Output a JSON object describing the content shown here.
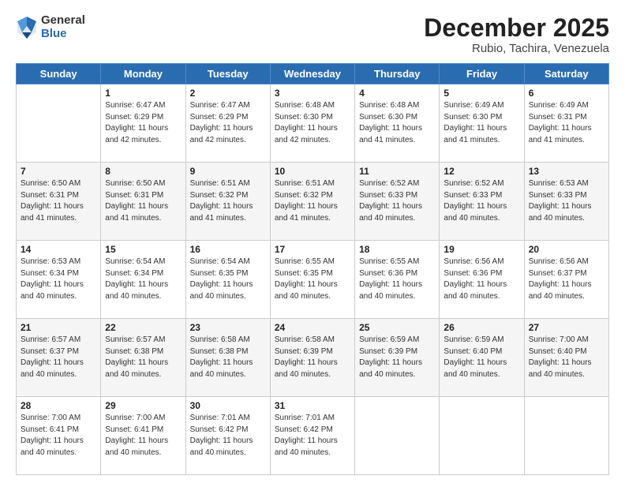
{
  "logo": {
    "general": "General",
    "blue": "Blue"
  },
  "header": {
    "month": "December 2025",
    "location": "Rubio, Tachira, Venezuela"
  },
  "days": [
    "Sunday",
    "Monday",
    "Tuesday",
    "Wednesday",
    "Thursday",
    "Friday",
    "Saturday"
  ],
  "weeks": [
    [
      {
        "num": "",
        "text": ""
      },
      {
        "num": "1",
        "text": "Sunrise: 6:47 AM\nSunset: 6:29 PM\nDaylight: 11 hours\nand 42 minutes."
      },
      {
        "num": "2",
        "text": "Sunrise: 6:47 AM\nSunset: 6:29 PM\nDaylight: 11 hours\nand 42 minutes."
      },
      {
        "num": "3",
        "text": "Sunrise: 6:48 AM\nSunset: 6:30 PM\nDaylight: 11 hours\nand 42 minutes."
      },
      {
        "num": "4",
        "text": "Sunrise: 6:48 AM\nSunset: 6:30 PM\nDaylight: 11 hours\nand 41 minutes."
      },
      {
        "num": "5",
        "text": "Sunrise: 6:49 AM\nSunset: 6:30 PM\nDaylight: 11 hours\nand 41 minutes."
      },
      {
        "num": "6",
        "text": "Sunrise: 6:49 AM\nSunset: 6:31 PM\nDaylight: 11 hours\nand 41 minutes."
      }
    ],
    [
      {
        "num": "7",
        "text": "Sunrise: 6:50 AM\nSunset: 6:31 PM\nDaylight: 11 hours\nand 41 minutes."
      },
      {
        "num": "8",
        "text": "Sunrise: 6:50 AM\nSunset: 6:31 PM\nDaylight: 11 hours\nand 41 minutes."
      },
      {
        "num": "9",
        "text": "Sunrise: 6:51 AM\nSunset: 6:32 PM\nDaylight: 11 hours\nand 41 minutes."
      },
      {
        "num": "10",
        "text": "Sunrise: 6:51 AM\nSunset: 6:32 PM\nDaylight: 11 hours\nand 41 minutes."
      },
      {
        "num": "11",
        "text": "Sunrise: 6:52 AM\nSunset: 6:33 PM\nDaylight: 11 hours\nand 40 minutes."
      },
      {
        "num": "12",
        "text": "Sunrise: 6:52 AM\nSunset: 6:33 PM\nDaylight: 11 hours\nand 40 minutes."
      },
      {
        "num": "13",
        "text": "Sunrise: 6:53 AM\nSunset: 6:33 PM\nDaylight: 11 hours\nand 40 minutes."
      }
    ],
    [
      {
        "num": "14",
        "text": "Sunrise: 6:53 AM\nSunset: 6:34 PM\nDaylight: 11 hours\nand 40 minutes."
      },
      {
        "num": "15",
        "text": "Sunrise: 6:54 AM\nSunset: 6:34 PM\nDaylight: 11 hours\nand 40 minutes."
      },
      {
        "num": "16",
        "text": "Sunrise: 6:54 AM\nSunset: 6:35 PM\nDaylight: 11 hours\nand 40 minutes."
      },
      {
        "num": "17",
        "text": "Sunrise: 6:55 AM\nSunset: 6:35 PM\nDaylight: 11 hours\nand 40 minutes."
      },
      {
        "num": "18",
        "text": "Sunrise: 6:55 AM\nSunset: 6:36 PM\nDaylight: 11 hours\nand 40 minutes."
      },
      {
        "num": "19",
        "text": "Sunrise: 6:56 AM\nSunset: 6:36 PM\nDaylight: 11 hours\nand 40 minutes."
      },
      {
        "num": "20",
        "text": "Sunrise: 6:56 AM\nSunset: 6:37 PM\nDaylight: 11 hours\nand 40 minutes."
      }
    ],
    [
      {
        "num": "21",
        "text": "Sunrise: 6:57 AM\nSunset: 6:37 PM\nDaylight: 11 hours\nand 40 minutes."
      },
      {
        "num": "22",
        "text": "Sunrise: 6:57 AM\nSunset: 6:38 PM\nDaylight: 11 hours\nand 40 minutes."
      },
      {
        "num": "23",
        "text": "Sunrise: 6:58 AM\nSunset: 6:38 PM\nDaylight: 11 hours\nand 40 minutes."
      },
      {
        "num": "24",
        "text": "Sunrise: 6:58 AM\nSunset: 6:39 PM\nDaylight: 11 hours\nand 40 minutes."
      },
      {
        "num": "25",
        "text": "Sunrise: 6:59 AM\nSunset: 6:39 PM\nDaylight: 11 hours\nand 40 minutes."
      },
      {
        "num": "26",
        "text": "Sunrise: 6:59 AM\nSunset: 6:40 PM\nDaylight: 11 hours\nand 40 minutes."
      },
      {
        "num": "27",
        "text": "Sunrise: 7:00 AM\nSunset: 6:40 PM\nDaylight: 11 hours\nand 40 minutes."
      }
    ],
    [
      {
        "num": "28",
        "text": "Sunrise: 7:00 AM\nSunset: 6:41 PM\nDaylight: 11 hours\nand 40 minutes."
      },
      {
        "num": "29",
        "text": "Sunrise: 7:00 AM\nSunset: 6:41 PM\nDaylight: 11 hours\nand 40 minutes."
      },
      {
        "num": "30",
        "text": "Sunrise: 7:01 AM\nSunset: 6:42 PM\nDaylight: 11 hours\nand 40 minutes."
      },
      {
        "num": "31",
        "text": "Sunrise: 7:01 AM\nSunset: 6:42 PM\nDaylight: 11 hours\nand 40 minutes."
      },
      {
        "num": "",
        "text": ""
      },
      {
        "num": "",
        "text": ""
      },
      {
        "num": "",
        "text": ""
      }
    ]
  ]
}
